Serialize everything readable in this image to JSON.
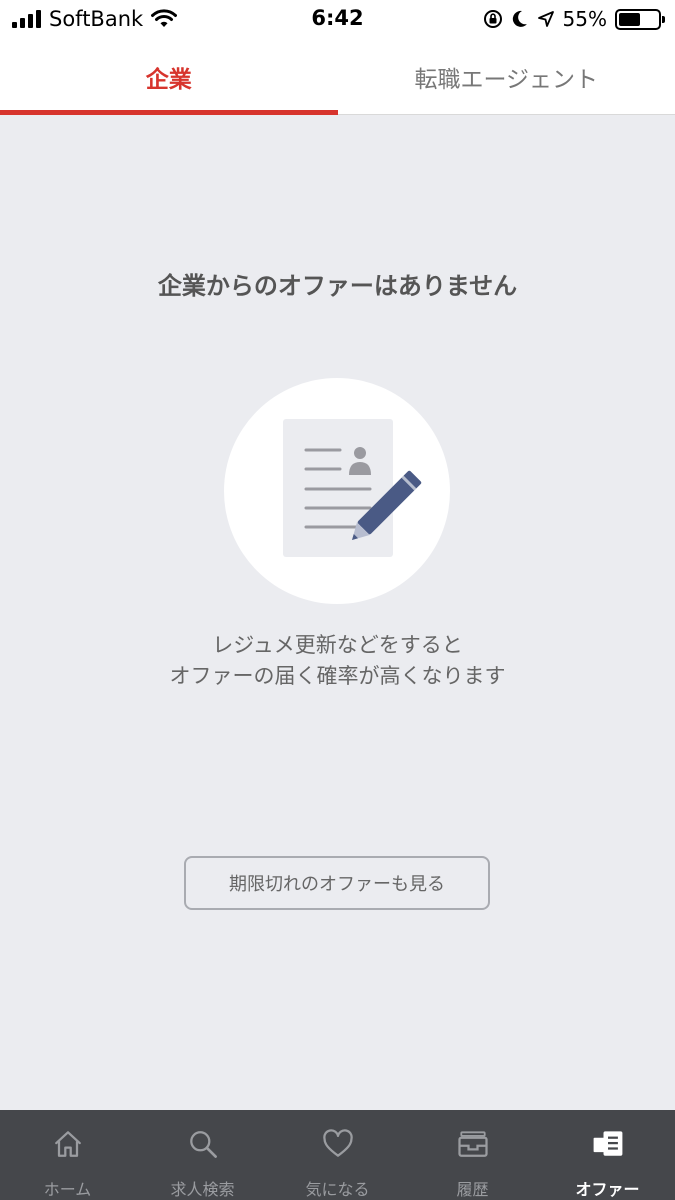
{
  "status_bar": {
    "carrier": "SoftBank",
    "time": "6:42",
    "battery_percent": "55%",
    "battery_level": 0.55,
    "icons": [
      "signal-icon",
      "wifi-icon",
      "orientation-lock-icon",
      "moon-icon",
      "location-icon",
      "battery-icon"
    ]
  },
  "tabs": [
    {
      "label": "企業",
      "active": true
    },
    {
      "label": "転職エージェント",
      "active": false
    }
  ],
  "empty_state": {
    "title": "企業からのオファーはありません",
    "description_line1": "レジュメ更新などをすると",
    "description_line2": "オファーの届く確率が高くなります",
    "illustration": "resume-with-pen-icon"
  },
  "expired_button_label": "期限切れのオファーも見る",
  "bottom_nav": [
    {
      "label": "ホーム",
      "icon": "home-icon",
      "active": false
    },
    {
      "label": "求人検索",
      "icon": "search-icon",
      "active": false
    },
    {
      "label": "気になる",
      "icon": "heart-icon",
      "active": false
    },
    {
      "label": "履歴",
      "icon": "history-tray-icon",
      "active": false
    },
    {
      "label": "オファー",
      "icon": "offer-icon",
      "active": true
    }
  ],
  "colors": {
    "accent": "#d7342d",
    "background": "#ebecf0",
    "nav_background": "#45474b",
    "pen": "#4a5a85"
  }
}
